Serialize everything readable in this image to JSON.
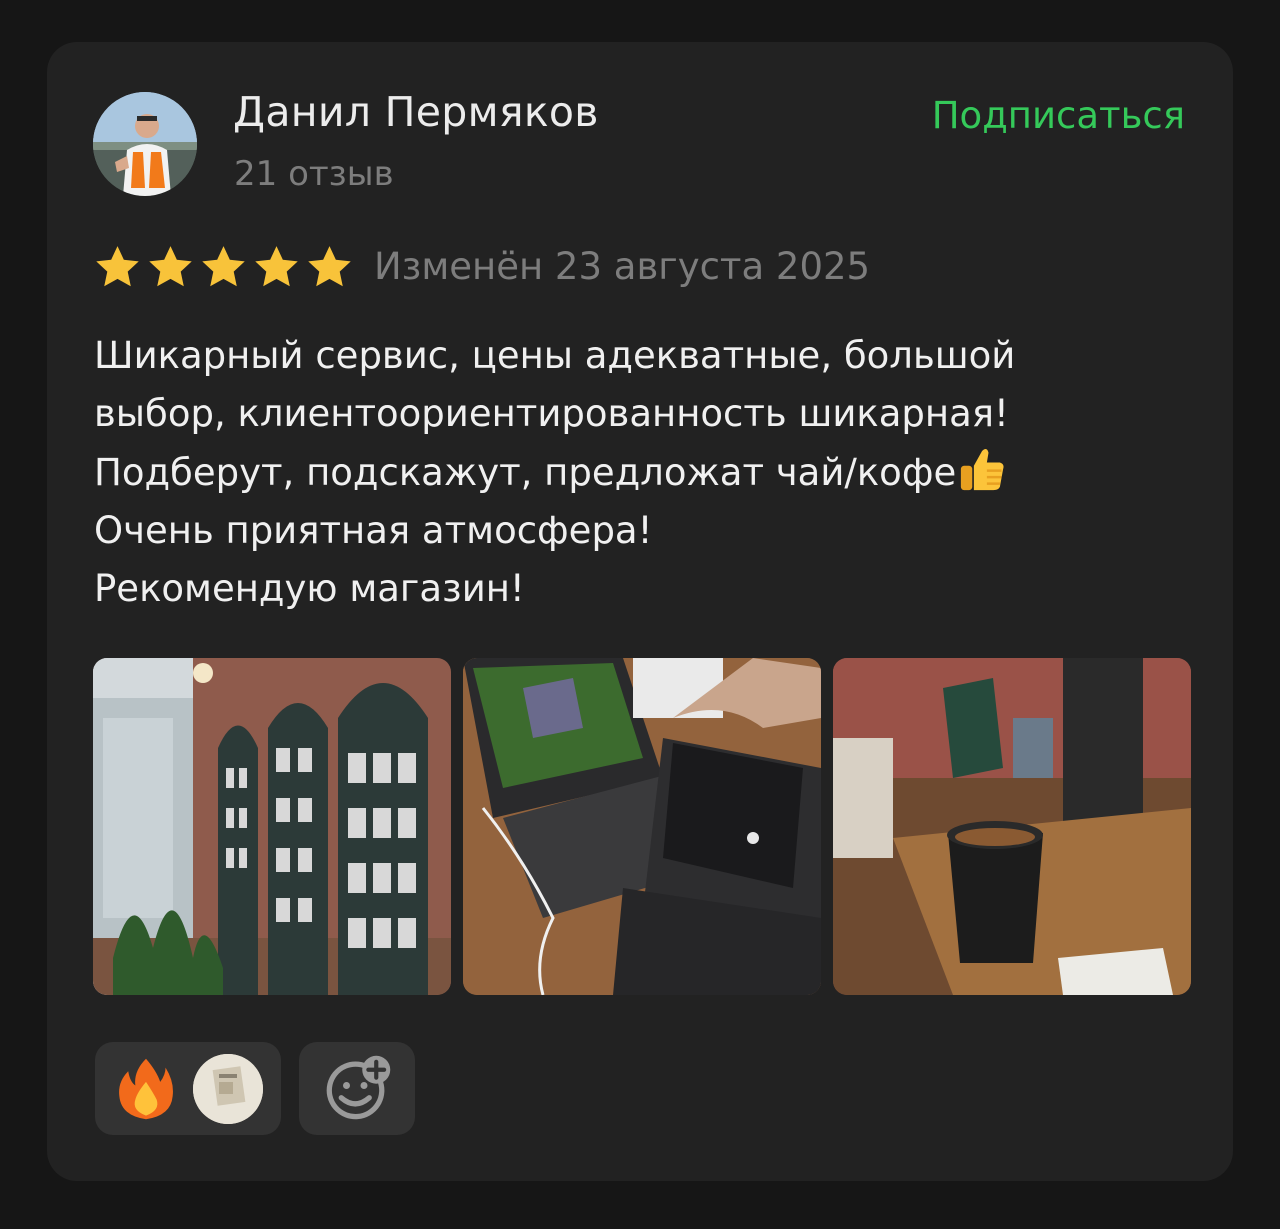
{
  "author": {
    "name": "Данил Пермяков",
    "reviews_count": "21 отзыв"
  },
  "subscribe_label": "Подписаться",
  "rating": {
    "stars": 5,
    "max": 5,
    "edited_text": "Изменён 23 августа 2025"
  },
  "review": {
    "lines": [
      "Шикарный сервис, цены адекватные, большой",
      "выбор, клиентоориентированность шикарная!",
      "Подберут, подскажут, предложат чай/кофе",
      "Очень приятная атмосфера!",
      "Рекомендую магазин!"
    ],
    "emoji_after_line_3": "thumbs-up"
  },
  "photos": [
    {
      "name": "store-shelves-photo"
    },
    {
      "name": "laptops-on-table-photo"
    },
    {
      "name": "coffee-cup-photo"
    }
  ],
  "reactions": [
    {
      "icon": "fire-icon"
    },
    {
      "icon": "user-avatar"
    }
  ],
  "add_reaction_icon": "add-emoji-icon",
  "colors": {
    "background": "#161616",
    "card": "#222222",
    "accent_green": "#35c95a",
    "star": "#f8c33a",
    "muted_text": "#7d7d7d",
    "pill": "#333333"
  }
}
